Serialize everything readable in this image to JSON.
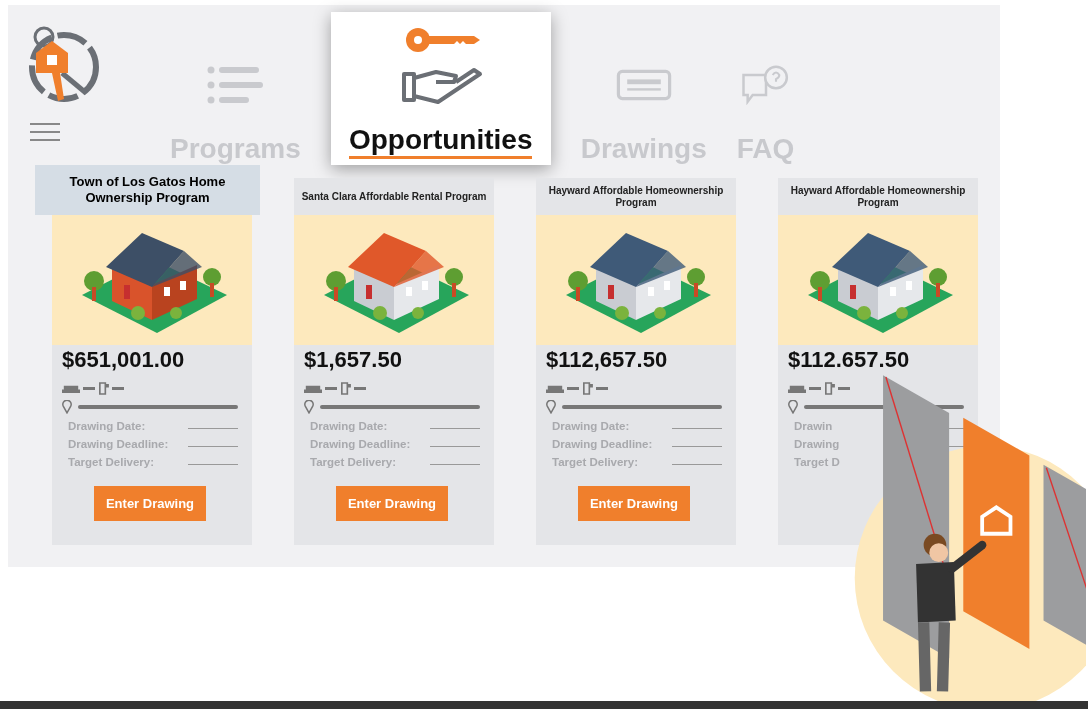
{
  "tabs": [
    {
      "label": "Programs",
      "kind": "list",
      "selected": false
    },
    {
      "label": "Opportunities",
      "kind": "offer",
      "selected": true
    },
    {
      "label": "Drawings",
      "kind": "ticket",
      "selected": false
    },
    {
      "label": "FAQ",
      "kind": "faq",
      "selected": false
    }
  ],
  "cards": [
    {
      "title": "Town of Los Gatos Home Ownership Program",
      "highlighted": true,
      "price": "$651,001.00",
      "details": [
        "Drawing Date:",
        "Drawing Deadline:",
        "Target Delivery:"
      ],
      "button": "Enter Drawing"
    },
    {
      "title": "Santa Clara Affordable Rental Program",
      "highlighted": false,
      "price": "$1,657.50",
      "details": [
        "Drawing Date:",
        "Drawing Deadline:",
        "Target Delivery:"
      ],
      "button": "Enter Drawing"
    },
    {
      "title": "Hayward Affordable Homeownership Program",
      "highlighted": false,
      "price": "$112,657.50",
      "details": [
        "Drawing Date:",
        "Drawing Deadline:",
        "Target Delivery:"
      ],
      "button": "Enter Drawing"
    },
    {
      "title": "Hayward Affordable Homeownership Program",
      "highlighted": false,
      "price": "$112.657.50",
      "details": [
        "Drawin",
        "Drawing",
        "Target D"
      ]
    }
  ]
}
